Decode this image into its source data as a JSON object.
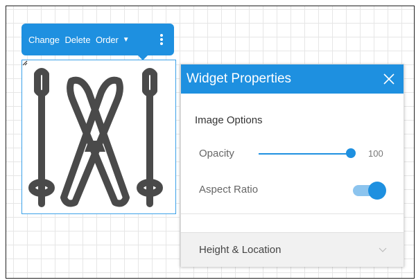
{
  "toolbar": {
    "change_label": "Change",
    "delete_label": "Delete",
    "order_label": "Order",
    "caret_icon": "caret-down-icon",
    "more_icon": "kebab-menu-icon"
  },
  "image_widget": {
    "image": "ski-and-poles-icon",
    "resize_icon": "resize-handle-icon"
  },
  "panel": {
    "title": "Widget Properties",
    "close_icon": "close-icon",
    "section_title": "Image Options",
    "opacity": {
      "label": "Opacity",
      "value": "100"
    },
    "aspect_ratio": {
      "label": "Aspect Ratio",
      "enabled": true
    },
    "accordion": {
      "label": "Height & Location",
      "chevron_icon": "chevron-down-icon"
    }
  },
  "colors": {
    "accent": "#1e90e0",
    "toggle_track": "#8cc4ee",
    "icon_dark": "#4a4a4a",
    "grid": "#e6e6e6"
  }
}
